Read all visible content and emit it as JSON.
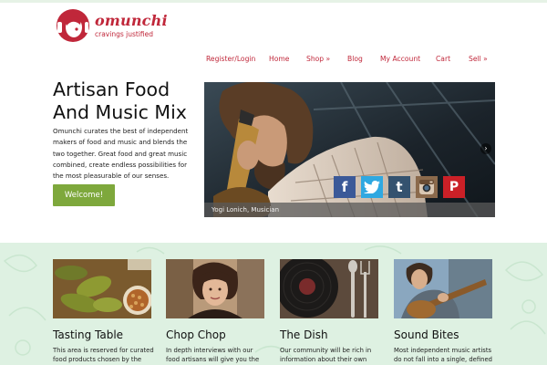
{
  "brand": {
    "name": "omunchi",
    "tagline": "cravings justified",
    "accent": "#c0273a"
  },
  "nav": [
    {
      "label": "Register/Login"
    },
    {
      "label": "Home"
    },
    {
      "label": "Shop »"
    },
    {
      "label": "Blog"
    },
    {
      "label": "My Account"
    },
    {
      "label": "Cart"
    },
    {
      "label": "Sell »"
    }
  ],
  "hero": {
    "title": "Artisan Food And Music Mix",
    "body": "Omunchi curates the best of independent makers of food and music and blends the two together. Great food and great music combined, create endless possibilities for the most pleasurable of our senses.",
    "button": "Welcome!",
    "button_color": "#7ea83c"
  },
  "slider": {
    "caption": "Yogi Lonich, Musician",
    "next_icon": "›"
  },
  "social": [
    {
      "name": "facebook-icon",
      "glyph": "f",
      "color": "#3b5998"
    },
    {
      "name": "twitter-icon",
      "glyph": "t",
      "color": "#2fa8e1"
    },
    {
      "name": "tumblr-icon",
      "glyph": "t",
      "color": "#34526f"
    },
    {
      "name": "instagram-icon",
      "glyph": "",
      "color": "#8b6a4c"
    },
    {
      "name": "pinterest-icon",
      "glyph": "P",
      "color": "#cb2027"
    }
  ],
  "band_color": "#def1e2",
  "cards": [
    {
      "title": "Tasting Table",
      "desc": "This area is reserved for curated food products chosen by the"
    },
    {
      "title": "Chop Chop",
      "desc": "In depth interviews with our food artisans will give you the"
    },
    {
      "title": "The Dish",
      "desc": "Our community will be rich in information about their own"
    },
    {
      "title": "Sound Bites",
      "desc": "Most independent music artists do not fall into a single, defined"
    }
  ]
}
